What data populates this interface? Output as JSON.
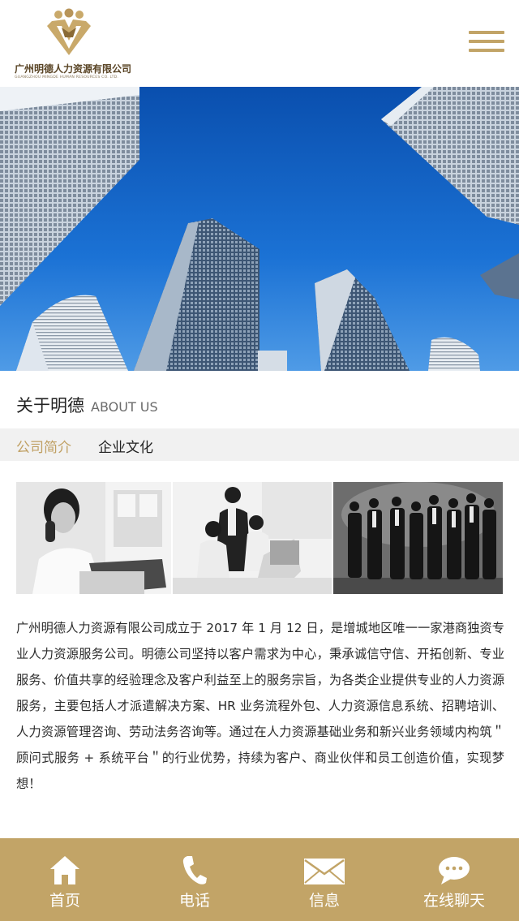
{
  "header": {
    "logo_cn": "广州明德人力资源有限公司",
    "logo_en": "GUANGZHOU MINGDE HUMAN RESOURCES CO. LTD.",
    "logo_icon": "people-crown-logo-icon",
    "menu_icon": "hamburger-menu-icon"
  },
  "banner": {
    "image": "skyscrapers-blue-sky-photo"
  },
  "about": {
    "title_cn": "关于明德",
    "title_en": "ABOUT US"
  },
  "tabs": [
    {
      "label": "公司简介",
      "active": true
    },
    {
      "label": "企业文化",
      "active": false
    }
  ],
  "photos": [
    {
      "name": "woman-on-phone-photo"
    },
    {
      "name": "office-team-at-computer-photo"
    },
    {
      "name": "business-group-photo"
    }
  ],
  "intro_text": "广州明德人力资源有限公司成立于 2017 年 1 月 12 日，是增城地区唯一一家港商独资专业人力资源服务公司。明德公司坚持以客户需求为中心，秉承诚信守信、开拓创新、专业服务、价值共享的经验理念及客户利益至上的服务宗旨，为各类企业提供专业的人力资源服务，主要包括人才派遣解决方案、HR 业务流程外包、人力资源信息系统、招聘培训、人力资源管理咨询、劳动法务咨询等。通过在人力资源基础业务和新兴业务领域内构筑＂顾问式服务 + 系统平台＂的行业优势，持续为客户、商业伙伴和员工创造价值，实现梦想！",
  "bottom_nav": [
    {
      "label": "首页",
      "icon": "home-icon"
    },
    {
      "label": "电话",
      "icon": "phone-icon"
    },
    {
      "label": "信息",
      "icon": "envelope-icon"
    },
    {
      "label": "在线聊天",
      "icon": "chat-bubble-icon"
    }
  ],
  "colors": {
    "accent": "#c2a467",
    "tab_active": "#c0a063",
    "tab_bar_bg": "#f1f1f1"
  }
}
